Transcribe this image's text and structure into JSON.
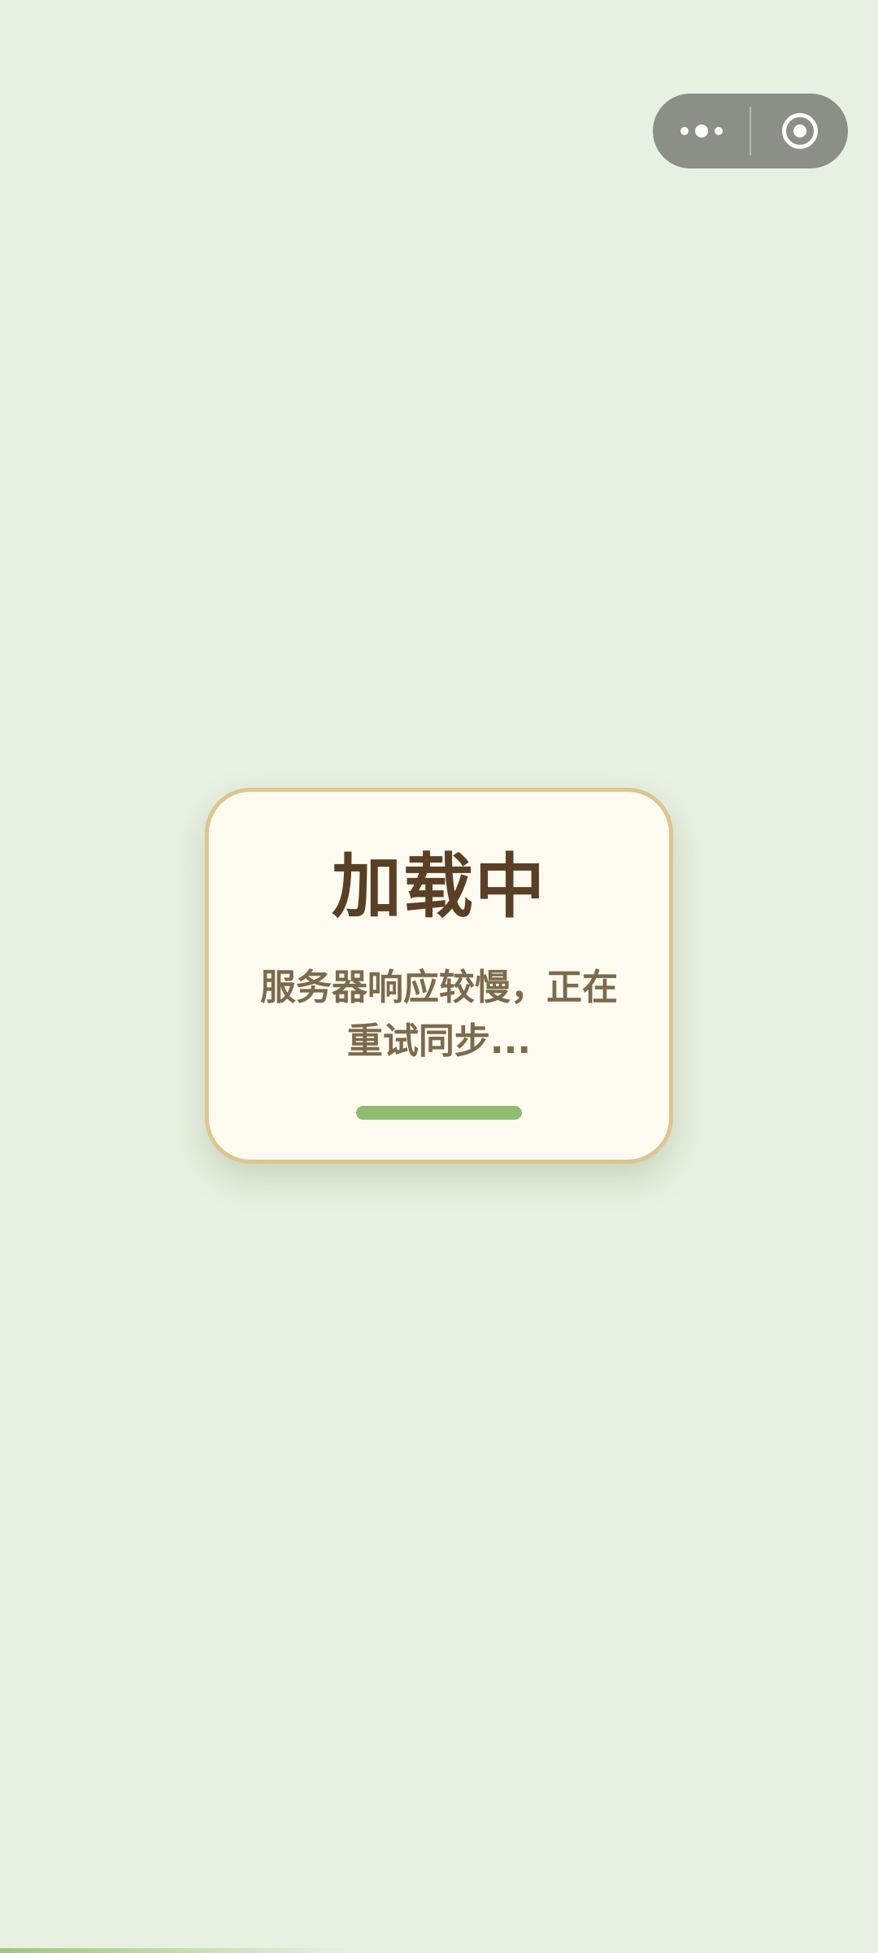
{
  "capsule": {
    "more_icon": "more-dots-icon",
    "close_icon": "target-circle-icon"
  },
  "dialog": {
    "title": "加载中",
    "message": "服务器响应较慢，正在重试同步...",
    "progress": 1.0
  },
  "colors": {
    "background": "#e8f0e1",
    "dialog_bg": "#fdfbf0",
    "dialog_border": "#ddc58f",
    "title": "#5a3f24",
    "message": "#7d6a4c",
    "progress": "#8fbb73"
  }
}
